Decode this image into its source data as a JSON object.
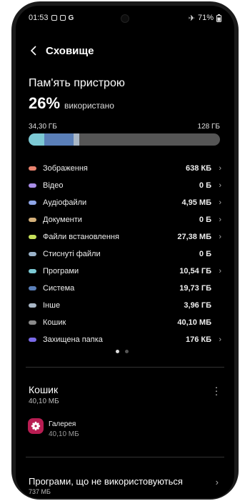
{
  "status_bar": {
    "time": "01:53",
    "battery": "71%"
  },
  "header": {
    "title": "Сховище"
  },
  "storage": {
    "section_title": "Пам'ять пристрою",
    "percent": "26%",
    "used_label": "використано",
    "used_size": "34,30 ГБ",
    "total_size": "128 ГБ",
    "fill_fraction": 0.26
  },
  "categories": [
    {
      "label": "Зображення",
      "value": "638 КБ",
      "color": "#e8826e",
      "chevron": true
    },
    {
      "label": "Відео",
      "value": "0 Б",
      "color": "#a98ee8",
      "chevron": true
    },
    {
      "label": "Аудіофайли",
      "value": "4,95 МБ",
      "color": "#8fa6e8",
      "chevron": true
    },
    {
      "label": "Документи",
      "value": "0 Б",
      "color": "#d4b07a",
      "chevron": true
    },
    {
      "label": "Файли встановлення",
      "value": "27,38 МБ",
      "color": "#c6e05a",
      "chevron": true
    },
    {
      "label": "Стиснуті файли",
      "value": "0 Б",
      "color": "#9ab2c9",
      "chevron": false
    },
    {
      "label": "Програми",
      "value": "10,54 ГБ",
      "color": "#7cc9d4",
      "chevron": true
    },
    {
      "label": "Система",
      "value": "19,73 ГБ",
      "color": "#5a7fb8",
      "chevron": false
    },
    {
      "label": "Інше",
      "value": "3,96 ГБ",
      "color": "#a9b7c6",
      "chevron": false
    },
    {
      "label": "Кошик",
      "value": "40,10 МБ",
      "color": "#8a8a8a",
      "chevron": false
    },
    {
      "label": "Захищена папка",
      "value": "176 КБ",
      "color": "#7a6ae8",
      "chevron": true
    }
  ],
  "bar_segments": [
    {
      "name": "Програми",
      "fraction": 0.082,
      "color": "#7cc9d4"
    },
    {
      "name": "Система",
      "fraction": 0.154,
      "color": "#5a7fb8"
    },
    {
      "name": "Інше",
      "fraction": 0.031,
      "color": "#a9b7c6"
    }
  ],
  "trash": {
    "title": "Кошик",
    "size": "40,10 МБ",
    "app_name": "Галерея",
    "app_size": "40,10 МБ"
  },
  "unused_apps": {
    "title": "Програми, що не використовуються",
    "size": "737 МБ"
  }
}
